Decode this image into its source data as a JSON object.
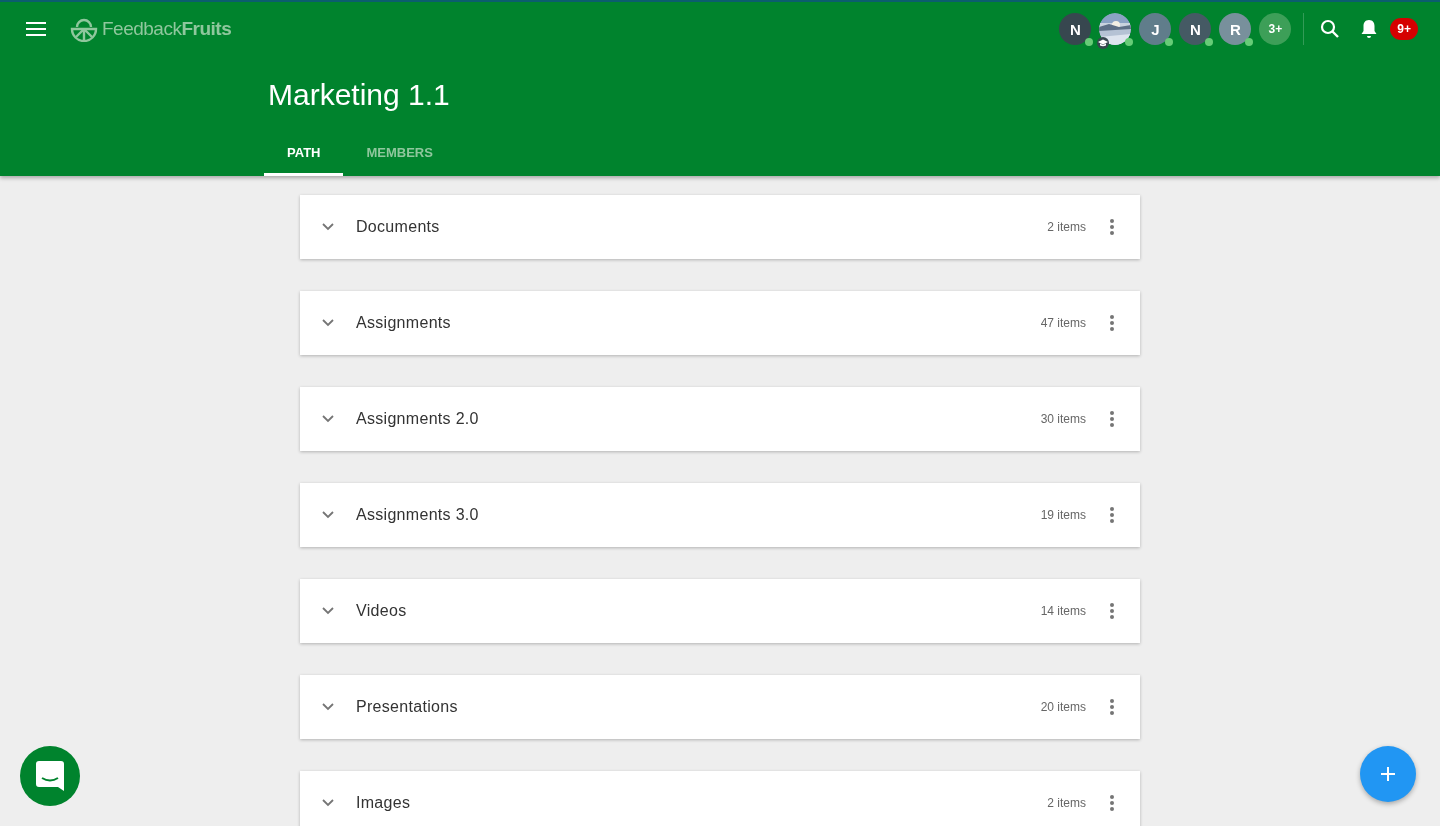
{
  "app": {
    "logo_light": "Feedback",
    "logo_bold": "Fruits"
  },
  "members": [
    {
      "kind": "letter",
      "initial": "N",
      "color": "#37474f",
      "online": true,
      "teacher": false
    },
    {
      "kind": "picture",
      "online": true,
      "teacher": true
    },
    {
      "kind": "letter",
      "initial": "J",
      "color": "#607d8b",
      "online": true,
      "teacher": false
    },
    {
      "kind": "letter",
      "initial": "N",
      "color": "#455a64",
      "online": true,
      "teacher": false
    },
    {
      "kind": "letter",
      "initial": "R",
      "color": "#78909c",
      "online": true,
      "teacher": false
    },
    {
      "kind": "more",
      "initial": "3+",
      "color": "#3d9f58"
    }
  ],
  "notifications": {
    "badge": "9+"
  },
  "course": {
    "title": "Marketing 1.1"
  },
  "tabs": [
    {
      "label": "PATH",
      "selected": true
    },
    {
      "label": "MEMBERS",
      "selected": false
    }
  ],
  "sections": [
    {
      "title": "Documents",
      "count": "2 items"
    },
    {
      "title": "Assignments",
      "count": "47 items"
    },
    {
      "title": "Assignments 2.0",
      "count": "30 items"
    },
    {
      "title": "Assignments 3.0",
      "count": "19 items"
    },
    {
      "title": "Videos",
      "count": "14 items"
    },
    {
      "title": "Presentations",
      "count": "20 items"
    },
    {
      "title": "Images",
      "count": "2 items"
    }
  ]
}
